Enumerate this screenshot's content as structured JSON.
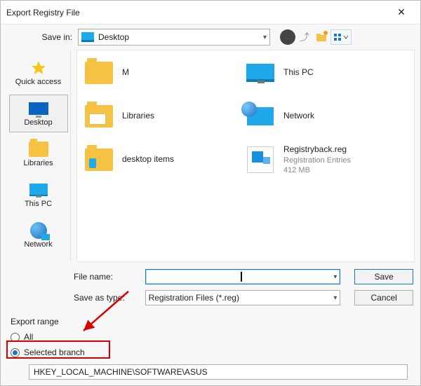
{
  "window": {
    "title": "Export Registry File",
    "close_glyph": "✕"
  },
  "toolbar": {
    "save_in_label": "Save in:",
    "current_location": "Desktop",
    "back_tooltip": "Back",
    "up_tooltip": "Up One Level",
    "newfolder_tooltip": "Create New Folder",
    "view_tooltip": "View Menu"
  },
  "places": {
    "quick_access": "Quick access",
    "desktop": "Desktop",
    "libraries": "Libraries",
    "this_pc": "This PC",
    "network": "Network"
  },
  "files": {
    "col1": [
      {
        "name": "M"
      },
      {
        "name": "Libraries"
      },
      {
        "name": "desktop items"
      }
    ],
    "col2": [
      {
        "name": "This PC"
      },
      {
        "name": "Network"
      },
      {
        "name": "Registryback.reg",
        "type": "Registration Entries",
        "size": "412 MB"
      }
    ]
  },
  "form": {
    "filename_label": "File name:",
    "filename_value": "",
    "saveastype_label": "Save as type:",
    "saveastype_value": "Registration Files (*.reg)",
    "save_button": "Save",
    "cancel_button": "Cancel"
  },
  "export_range": {
    "legend": "Export range",
    "all": "All",
    "selected_branch": "Selected branch",
    "branch_path": "HKEY_LOCAL_MACHINE\\SOFTWARE\\ASUS",
    "selected": "selected_branch"
  }
}
